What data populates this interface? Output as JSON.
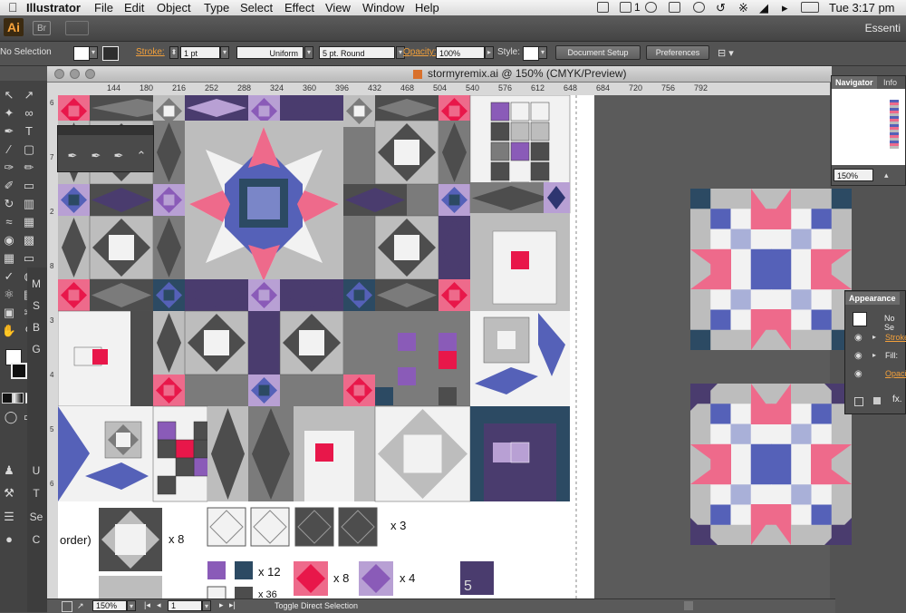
{
  "menubar": {
    "apple": "",
    "app_name": "Illustrator",
    "items": [
      "File",
      "Edit",
      "Object",
      "Type",
      "Select",
      "Effect",
      "View",
      "Window",
      "Help"
    ],
    "clock": "Tue 3:17 pm",
    "notify_count": "1"
  },
  "appbar": {
    "ai_logo": "Ai",
    "br_logo": "Br",
    "workspace": "Essenti"
  },
  "control": {
    "selection": "No Selection",
    "stroke_label": "Stroke:",
    "stroke_value": "1 pt",
    "profile": "Uniform",
    "brush": "5 pt. Round",
    "opacity_label": "Opacity:",
    "opacity_value": "100%",
    "style_label": "Style:",
    "document_setup": "Document Setup",
    "preferences": "Preferences"
  },
  "document": {
    "title": "stormyremix.ai @ 150% (CMYK/Preview)"
  },
  "ruler": {
    "ticks": [
      "144",
      "180",
      "216",
      "252",
      "288",
      "324",
      "360",
      "396",
      "432",
      "468",
      "504",
      "540",
      "576",
      "612",
      "648",
      "684",
      "720",
      "756",
      "792"
    ],
    "vticks": [
      "6",
      "7",
      "2",
      "8",
      "3",
      "4",
      "5",
      "6"
    ]
  },
  "status": {
    "zoom": "150%",
    "page": "1",
    "message": "Toggle Direct Selection"
  },
  "navigator": {
    "tab_navigator": "Navigator",
    "tab_info": "Info",
    "zoom": "150%"
  },
  "appearance": {
    "title": "Appearance",
    "selection": "No Se",
    "stroke": "Stroke",
    "fill": "Fill:",
    "opacity": "Opaci",
    "fx": "fx."
  },
  "legend": {
    "border_label": "order)",
    "counts": [
      "x 8",
      "x 3",
      "x 12",
      "x 8",
      "x 4",
      "x 36"
    ],
    "five": "5"
  },
  "colors": {
    "purple_dark": "#4a3c6e",
    "purple": "#8a5bb8",
    "slate": "#2c4a63",
    "periwinkle": "#5561b8",
    "lavender": "#b8a0d4",
    "pink": "#ee6a8b",
    "red": "#e8174a",
    "gray_dark": "#4d4d4d",
    "gray": "#7b7b7b",
    "gray_light": "#bdbdbd",
    "white": "#f2f2f2",
    "accent_orange": "#f2a03b"
  }
}
